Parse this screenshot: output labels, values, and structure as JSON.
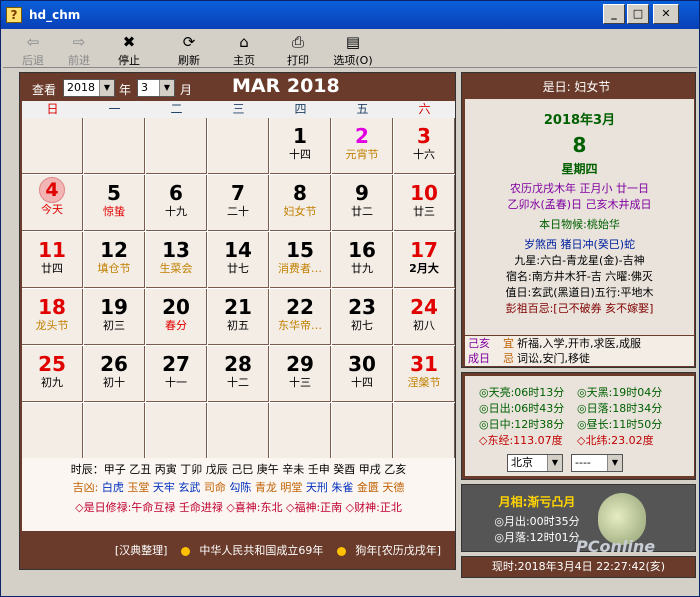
{
  "window": {
    "title": "hd_chm",
    "buttons": [
      "_",
      "□",
      "✕"
    ]
  },
  "toolbar": [
    {
      "label": "后退",
      "icon": "⇦",
      "enabled": false
    },
    {
      "label": "前进",
      "icon": "⇨",
      "enabled": false
    },
    {
      "label": "停止",
      "icon": "✖",
      "enabled": true
    },
    {
      "label": "刷新",
      "icon": "⟳",
      "enabled": true
    },
    {
      "label": "主页",
      "icon": "⌂",
      "enabled": true
    },
    {
      "label": "打印",
      "icon": "⎙",
      "enabled": true
    },
    {
      "label": "选项(O)",
      "icon": "▤",
      "enabled": true
    }
  ],
  "calendar": {
    "view_label": "查看",
    "year_value": "2018",
    "year_unit": "年",
    "month_value": "3",
    "month_unit": "月",
    "month_title": "MAR 2018",
    "weekdays": [
      "日",
      "一",
      "二",
      "三",
      "四",
      "五",
      "六"
    ],
    "days": [
      {
        "d": "1",
        "l": "十四",
        "dc": "#000",
        "lc": "#000"
      },
      {
        "d": "2",
        "l": "元宵节",
        "dc": "#e000e0",
        "lc": "#c08000"
      },
      {
        "d": "3",
        "l": "十六",
        "dc": "#e00000",
        "lc": "#000"
      },
      {
        "d": "4",
        "l": "今天",
        "dc": "#e00000",
        "lc": "#e00000",
        "today": true
      },
      {
        "d": "5",
        "l": "惊蛰",
        "dc": "#000",
        "lc": "#e00000"
      },
      {
        "d": "6",
        "l": "十九",
        "dc": "#000",
        "lc": "#000"
      },
      {
        "d": "7",
        "l": "二十",
        "dc": "#000",
        "lc": "#000"
      },
      {
        "d": "8",
        "l": "妇女节",
        "dc": "#000",
        "lc": "#c08000"
      },
      {
        "d": "9",
        "l": "廿二",
        "dc": "#000",
        "lc": "#000"
      },
      {
        "d": "10",
        "l": "廿三",
        "dc": "#e00000",
        "lc": "#000"
      },
      {
        "d": "11",
        "l": "廿四",
        "dc": "#e00000",
        "lc": "#000"
      },
      {
        "d": "12",
        "l": "填仓节",
        "dc": "#000",
        "lc": "#c08000"
      },
      {
        "d": "13",
        "l": "生菜会",
        "dc": "#000",
        "lc": "#c08000"
      },
      {
        "d": "14",
        "l": "廿七",
        "dc": "#000",
        "lc": "#000"
      },
      {
        "d": "15",
        "l": "消费者…",
        "dc": "#000",
        "lc": "#c08000"
      },
      {
        "d": "16",
        "l": "廿九",
        "dc": "#000",
        "lc": "#000"
      },
      {
        "d": "17",
        "l": "2月大",
        "dc": "#e00000",
        "lc": "#000",
        "bold": true
      },
      {
        "d": "18",
        "l": "龙头节",
        "dc": "#e00000",
        "lc": "#c08000"
      },
      {
        "d": "19",
        "l": "初三",
        "dc": "#000",
        "lc": "#000"
      },
      {
        "d": "20",
        "l": "春分",
        "dc": "#000",
        "lc": "#e00000"
      },
      {
        "d": "21",
        "l": "初五",
        "dc": "#000",
        "lc": "#000"
      },
      {
        "d": "22",
        "l": "东华帝…",
        "dc": "#000",
        "lc": "#c08000"
      },
      {
        "d": "23",
        "l": "初七",
        "dc": "#000",
        "lc": "#000"
      },
      {
        "d": "24",
        "l": "初八",
        "dc": "#e00000",
        "lc": "#000"
      },
      {
        "d": "25",
        "l": "初九",
        "dc": "#e00000",
        "lc": "#000"
      },
      {
        "d": "26",
        "l": "初十",
        "dc": "#000",
        "lc": "#000"
      },
      {
        "d": "27",
        "l": "十一",
        "dc": "#000",
        "lc": "#000"
      },
      {
        "d": "28",
        "l": "十二",
        "dc": "#000",
        "lc": "#000"
      },
      {
        "d": "29",
        "l": "十三",
        "dc": "#000",
        "lc": "#000"
      },
      {
        "d": "30",
        "l": "十四",
        "dc": "#000",
        "lc": "#000"
      },
      {
        "d": "31",
        "l": "涅槃节",
        "dc": "#e00000",
        "lc": "#c08000"
      }
    ],
    "first_weekday": 4,
    "shichen": "时辰：甲子 乙丑 丙寅 丁卯 戊辰 己巳 庚午 辛未 壬申 癸酉 甲戌 乙亥",
    "jixiong_label": "吉凶:",
    "jixiong": [
      "白虎",
      "玉堂",
      "天牢",
      "玄武",
      "司命",
      "勾陈",
      "青龙",
      "明堂",
      "天刑",
      "朱雀",
      "金匮",
      "天德"
    ],
    "gods": "◇是日修禄:午命互禄  壬命进禄    ◇喜神:东北  ◇福神:正南  ◇财神:正北",
    "footer_source": "[汉典整理]",
    "footer_event": "中华人民共和国成立69年",
    "footer_year": "狗年[农历戊戌年]"
  },
  "right": {
    "festival": "是日: 妇女节",
    "ymd": "2018年3月",
    "day": "8",
    "weekday": "星期四",
    "lunar1": "农历戊戌木年 正月小 廿一日",
    "lunar2": "乙卯水(孟春)日 己亥木井成日",
    "phenology": "本日物候:桃始华",
    "chong": "岁煞西  猪日冲(癸巳)蛇",
    "stars": "九星:六白-青龙星(金)-吉神",
    "mansion": "宿名:南方井木犴-吉 六曜:佛灭",
    "duty": "值日:玄武(黑道日)五行:平地木",
    "pengzu": "彭祖百忌:[己不破券 亥不嫁娶]",
    "yi_day": "己亥",
    "ji_day": "成日",
    "yi_label": "宜",
    "ji_label": "忌",
    "yi": "祈福,入学,开市,求医,成服",
    "ji": "词讼,安门,移徙",
    "sun": [
      [
        "◎天亮:06时13分",
        "◎天黑:19时04分"
      ],
      [
        "◎日出:06时43分",
        "◎日落:18时34分"
      ],
      [
        "◎日中:12时38分",
        "◎昼长:11时50分"
      ]
    ],
    "coord": [
      "◇东经:113.07度",
      "◇北纬:23.02度"
    ],
    "city": "北京",
    "city2": "----",
    "moon_title": "月相:渐亏凸月",
    "moonrise": "◎月出:00时35分",
    "moonset": "◎月落:12时01分",
    "now": "现时:2018年3月4日 22:27:42(亥)"
  },
  "watermark": "PConline"
}
